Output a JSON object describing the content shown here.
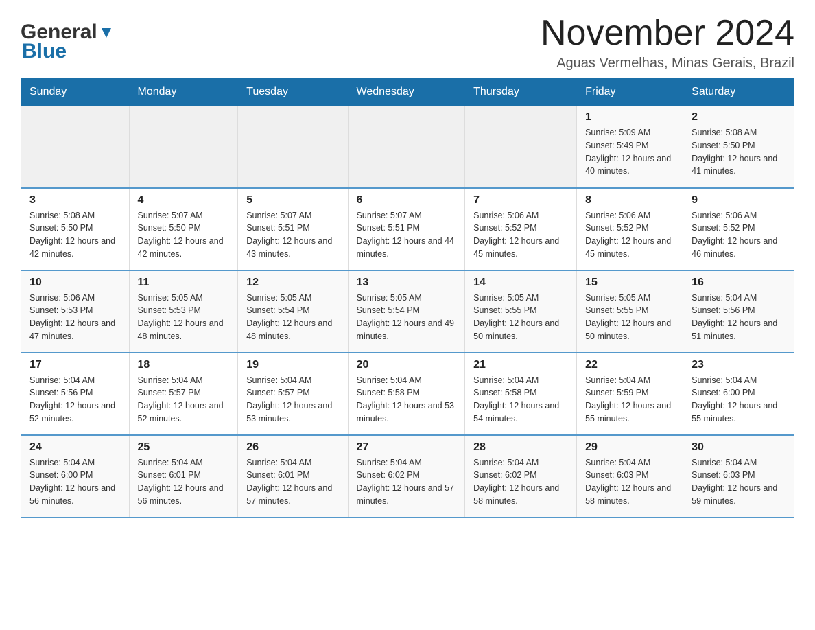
{
  "logo": {
    "text1": "General",
    "text2": "Blue"
  },
  "title": "November 2024",
  "subtitle": "Aguas Vermelhas, Minas Gerais, Brazil",
  "days_of_week": [
    "Sunday",
    "Monday",
    "Tuesday",
    "Wednesday",
    "Thursday",
    "Friday",
    "Saturday"
  ],
  "weeks": [
    {
      "cells": [
        {
          "empty": true
        },
        {
          "empty": true
        },
        {
          "empty": true
        },
        {
          "empty": true
        },
        {
          "empty": true
        },
        {
          "day": "1",
          "sunrise": "Sunrise: 5:09 AM",
          "sunset": "Sunset: 5:49 PM",
          "daylight": "Daylight: 12 hours and 40 minutes."
        },
        {
          "day": "2",
          "sunrise": "Sunrise: 5:08 AM",
          "sunset": "Sunset: 5:50 PM",
          "daylight": "Daylight: 12 hours and 41 minutes."
        }
      ]
    },
    {
      "cells": [
        {
          "day": "3",
          "sunrise": "Sunrise: 5:08 AM",
          "sunset": "Sunset: 5:50 PM",
          "daylight": "Daylight: 12 hours and 42 minutes."
        },
        {
          "day": "4",
          "sunrise": "Sunrise: 5:07 AM",
          "sunset": "Sunset: 5:50 PM",
          "daylight": "Daylight: 12 hours and 42 minutes."
        },
        {
          "day": "5",
          "sunrise": "Sunrise: 5:07 AM",
          "sunset": "Sunset: 5:51 PM",
          "daylight": "Daylight: 12 hours and 43 minutes."
        },
        {
          "day": "6",
          "sunrise": "Sunrise: 5:07 AM",
          "sunset": "Sunset: 5:51 PM",
          "daylight": "Daylight: 12 hours and 44 minutes."
        },
        {
          "day": "7",
          "sunrise": "Sunrise: 5:06 AM",
          "sunset": "Sunset: 5:52 PM",
          "daylight": "Daylight: 12 hours and 45 minutes."
        },
        {
          "day": "8",
          "sunrise": "Sunrise: 5:06 AM",
          "sunset": "Sunset: 5:52 PM",
          "daylight": "Daylight: 12 hours and 45 minutes."
        },
        {
          "day": "9",
          "sunrise": "Sunrise: 5:06 AM",
          "sunset": "Sunset: 5:52 PM",
          "daylight": "Daylight: 12 hours and 46 minutes."
        }
      ]
    },
    {
      "cells": [
        {
          "day": "10",
          "sunrise": "Sunrise: 5:06 AM",
          "sunset": "Sunset: 5:53 PM",
          "daylight": "Daylight: 12 hours and 47 minutes."
        },
        {
          "day": "11",
          "sunrise": "Sunrise: 5:05 AM",
          "sunset": "Sunset: 5:53 PM",
          "daylight": "Daylight: 12 hours and 48 minutes."
        },
        {
          "day": "12",
          "sunrise": "Sunrise: 5:05 AM",
          "sunset": "Sunset: 5:54 PM",
          "daylight": "Daylight: 12 hours and 48 minutes."
        },
        {
          "day": "13",
          "sunrise": "Sunrise: 5:05 AM",
          "sunset": "Sunset: 5:54 PM",
          "daylight": "Daylight: 12 hours and 49 minutes."
        },
        {
          "day": "14",
          "sunrise": "Sunrise: 5:05 AM",
          "sunset": "Sunset: 5:55 PM",
          "daylight": "Daylight: 12 hours and 50 minutes."
        },
        {
          "day": "15",
          "sunrise": "Sunrise: 5:05 AM",
          "sunset": "Sunset: 5:55 PM",
          "daylight": "Daylight: 12 hours and 50 minutes."
        },
        {
          "day": "16",
          "sunrise": "Sunrise: 5:04 AM",
          "sunset": "Sunset: 5:56 PM",
          "daylight": "Daylight: 12 hours and 51 minutes."
        }
      ]
    },
    {
      "cells": [
        {
          "day": "17",
          "sunrise": "Sunrise: 5:04 AM",
          "sunset": "Sunset: 5:56 PM",
          "daylight": "Daylight: 12 hours and 52 minutes."
        },
        {
          "day": "18",
          "sunrise": "Sunrise: 5:04 AM",
          "sunset": "Sunset: 5:57 PM",
          "daylight": "Daylight: 12 hours and 52 minutes."
        },
        {
          "day": "19",
          "sunrise": "Sunrise: 5:04 AM",
          "sunset": "Sunset: 5:57 PM",
          "daylight": "Daylight: 12 hours and 53 minutes."
        },
        {
          "day": "20",
          "sunrise": "Sunrise: 5:04 AM",
          "sunset": "Sunset: 5:58 PM",
          "daylight": "Daylight: 12 hours and 53 minutes."
        },
        {
          "day": "21",
          "sunrise": "Sunrise: 5:04 AM",
          "sunset": "Sunset: 5:58 PM",
          "daylight": "Daylight: 12 hours and 54 minutes."
        },
        {
          "day": "22",
          "sunrise": "Sunrise: 5:04 AM",
          "sunset": "Sunset: 5:59 PM",
          "daylight": "Daylight: 12 hours and 55 minutes."
        },
        {
          "day": "23",
          "sunrise": "Sunrise: 5:04 AM",
          "sunset": "Sunset: 6:00 PM",
          "daylight": "Daylight: 12 hours and 55 minutes."
        }
      ]
    },
    {
      "cells": [
        {
          "day": "24",
          "sunrise": "Sunrise: 5:04 AM",
          "sunset": "Sunset: 6:00 PM",
          "daylight": "Daylight: 12 hours and 56 minutes."
        },
        {
          "day": "25",
          "sunrise": "Sunrise: 5:04 AM",
          "sunset": "Sunset: 6:01 PM",
          "daylight": "Daylight: 12 hours and 56 minutes."
        },
        {
          "day": "26",
          "sunrise": "Sunrise: 5:04 AM",
          "sunset": "Sunset: 6:01 PM",
          "daylight": "Daylight: 12 hours and 57 minutes."
        },
        {
          "day": "27",
          "sunrise": "Sunrise: 5:04 AM",
          "sunset": "Sunset: 6:02 PM",
          "daylight": "Daylight: 12 hours and 57 minutes."
        },
        {
          "day": "28",
          "sunrise": "Sunrise: 5:04 AM",
          "sunset": "Sunset: 6:02 PM",
          "daylight": "Daylight: 12 hours and 58 minutes."
        },
        {
          "day": "29",
          "sunrise": "Sunrise: 5:04 AM",
          "sunset": "Sunset: 6:03 PM",
          "daylight": "Daylight: 12 hours and 58 minutes."
        },
        {
          "day": "30",
          "sunrise": "Sunrise: 5:04 AM",
          "sunset": "Sunset: 6:03 PM",
          "daylight": "Daylight: 12 hours and 59 minutes."
        }
      ]
    }
  ]
}
